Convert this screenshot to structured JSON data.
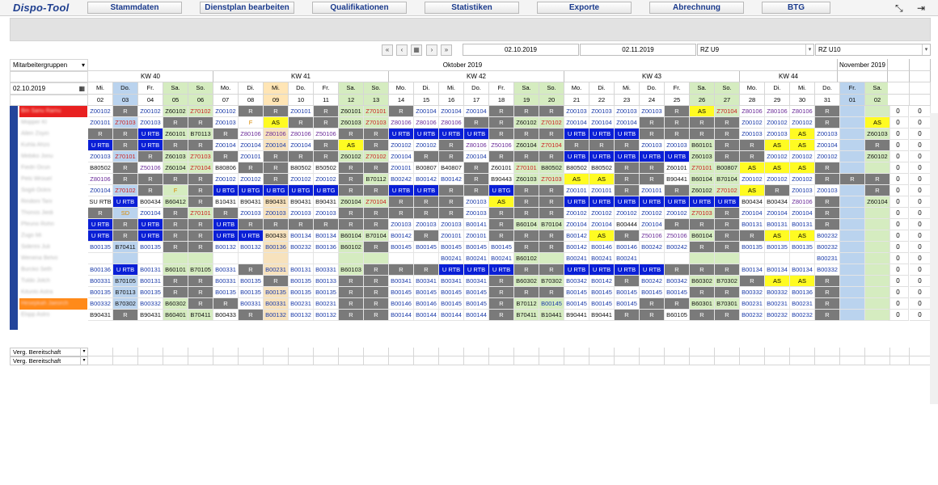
{
  "app": {
    "title": "Dispo-Tool"
  },
  "nav": [
    "Stammdaten",
    "Dienstplan bearbeiten",
    "Qualifikationen",
    "Statistiken",
    "Exporte",
    "Abrechnung",
    "BTG"
  ],
  "icons": {
    "collapse": "collapse-arrows-icon",
    "logout": "logout-icon"
  },
  "toolbar": {
    "first": "«",
    "prev": "‹",
    "calendar": "calendar-icon",
    "next": "›",
    "last": "»",
    "date_from": "02.10.2019",
    "date_to": "02.11.2019",
    "rz_left": "RZ U9",
    "rz_right": "RZ U10"
  },
  "filters": {
    "group_label": "Mitarbeitergruppen",
    "date": "02.10.2019"
  },
  "months": [
    {
      "label": "Oktober 2019"
    },
    {
      "label": "November 2019"
    }
  ],
  "weeks": [
    "KW 40",
    "KW 41",
    "KW 42",
    "KW 43",
    "KW 44"
  ],
  "days": [
    {
      "d": "Mi.",
      "n": "02",
      "k": "dn"
    },
    {
      "d": "Do.",
      "n": "03",
      "k": "dn h"
    },
    {
      "d": "Fr.",
      "n": "04",
      "k": "dn"
    },
    {
      "d": "Sa.",
      "n": "05",
      "k": "dn w"
    },
    {
      "d": "So.",
      "n": "06",
      "k": "dn w"
    },
    {
      "d": "Mo.",
      "n": "07",
      "k": "dn"
    },
    {
      "d": "Di.",
      "n": "08",
      "k": "dn"
    },
    {
      "d": "Mi.",
      "n": "09",
      "k": "dn s"
    },
    {
      "d": "Do.",
      "n": "10",
      "k": "dn"
    },
    {
      "d": "Fr.",
      "n": "11",
      "k": "dn"
    },
    {
      "d": "Sa.",
      "n": "12",
      "k": "dn w"
    },
    {
      "d": "So.",
      "n": "13",
      "k": "dn w"
    },
    {
      "d": "Mo.",
      "n": "14",
      "k": "dn"
    },
    {
      "d": "Di.",
      "n": "15",
      "k": "dn"
    },
    {
      "d": "Mi.",
      "n": "16",
      "k": "dn"
    },
    {
      "d": "Do.",
      "n": "17",
      "k": "dn"
    },
    {
      "d": "Fr.",
      "n": "18",
      "k": "dn"
    },
    {
      "d": "Sa.",
      "n": "19",
      "k": "dn w"
    },
    {
      "d": "So.",
      "n": "20",
      "k": "dn w"
    },
    {
      "d": "Mo.",
      "n": "21",
      "k": "dn"
    },
    {
      "d": "Di.",
      "n": "22",
      "k": "dn"
    },
    {
      "d": "Mi.",
      "n": "23",
      "k": "dn"
    },
    {
      "d": "Do.",
      "n": "24",
      "k": "dn"
    },
    {
      "d": "Fr.",
      "n": "25",
      "k": "dn"
    },
    {
      "d": "Sa.",
      "n": "26",
      "k": "dn w"
    },
    {
      "d": "So.",
      "n": "27",
      "k": "dn w"
    },
    {
      "d": "Mo.",
      "n": "28",
      "k": "dn"
    },
    {
      "d": "Di.",
      "n": "29",
      "k": "dn"
    },
    {
      "d": "Mi.",
      "n": "30",
      "k": "dn"
    },
    {
      "d": "Do.",
      "n": "31",
      "k": "dn"
    },
    {
      "d": "Fr.",
      "n": "01",
      "k": "dn h"
    },
    {
      "d": "Sa.",
      "n": "02",
      "k": "dn w"
    }
  ],
  "rows": [
    {
      "cells": [
        "Z00102",
        "R",
        "Z00102",
        "Z60102",
        "Z70102",
        "Z00102",
        "R",
        "R",
        "Z00101",
        "R",
        "Z60101",
        "Z70101",
        "R",
        "Z00104",
        "Z00104",
        "Z00104",
        "R",
        "R",
        "R",
        "Z00103",
        "Z00103",
        "Z00103",
        "Z00103",
        "R",
        "AS",
        "Z70104",
        "Z80106",
        "Z80106",
        "Z80106",
        "R",
        "",
        ""
      ],
      "a": "0",
      "b": "0"
    },
    {
      "cells": [
        "Z00101",
        "Z70103",
        "Z00103",
        "R",
        "R",
        "Z00103",
        "F",
        "AS",
        "R",
        "R",
        "Z60103",
        "Z70103",
        "Z80106",
        "Z80106",
        "Z80106",
        "R",
        "R",
        "Z60102",
        "Z70102",
        "Z00104",
        "Z00104",
        "Z00104",
        "R",
        "R",
        "R",
        "R",
        "Z00102",
        "Z00102",
        "Z00102",
        "R",
        "",
        "AS"
      ],
      "a": "0",
      "b": "0"
    },
    {
      "cells": [
        "R",
        "R",
        "U RTB",
        "Z60101",
        "B70113",
        "R",
        "Z80106",
        "Z80106",
        "Z80106",
        "Z50106",
        "R",
        "R",
        "U RTB",
        "U RTB",
        "U RTB",
        "U RTB",
        "R",
        "R",
        "R",
        "U RTB",
        "U RTB",
        "U RTB",
        "R",
        "R",
        "R",
        "R",
        "Z00103",
        "Z00103",
        "AS",
        "Z00103",
        "",
        "Z60103"
      ],
      "a": "0",
      "b": "0"
    },
    {
      "cells": [
        "U RTB",
        "R",
        "U RTB",
        "R",
        "R",
        "Z00104",
        "Z00104",
        "Z00104",
        "Z00104",
        "R",
        "AS",
        "R",
        "Z00102",
        "Z00102",
        "R",
        "Z80106",
        "Z50106",
        "Z60104",
        "Z70104",
        "R",
        "R",
        "R",
        "Z00103",
        "Z00103",
        "B60101",
        "R",
        "R",
        "AS",
        "AS",
        "Z00104",
        "",
        "R"
      ],
      "a": "0",
      "b": "0"
    },
    {
      "cells": [
        "Z00103",
        "Z70101",
        "R",
        "Z60103",
        "Z70103",
        "R",
        "Z00101",
        "R",
        "R",
        "R",
        "Z60102",
        "Z70102",
        "Z00104",
        "R",
        "R",
        "Z00104",
        "R",
        "R",
        "R",
        "U RTB",
        "U RTB",
        "U RTB",
        "U RTB",
        "U RTB",
        "Z60103",
        "R",
        "R",
        "Z00102",
        "Z00102",
        "Z00102",
        "",
        "Z60102"
      ],
      "a": "0",
      "b": "0"
    },
    {
      "cells": [
        "B80502",
        "R",
        "Z50106",
        "Z60104",
        "Z70104",
        "B80806",
        "R",
        "R",
        "B80502",
        "B50502",
        "R",
        "R",
        "Z00101",
        "B00807",
        "B40807",
        "R",
        "Z60101",
        "Z70101",
        "B80502",
        "B80502",
        "B80502",
        "R",
        "R",
        "Z60101",
        "Z70101",
        "B00807",
        "AS",
        "AS",
        "AS",
        "R",
        "",
        ""
      ],
      "a": "0",
      "b": "0"
    },
    {
      "cells": [
        "Z80106",
        "R",
        "R",
        "R",
        "R",
        "Z00102",
        "Z00102",
        "R",
        "Z00102",
        "Z00102",
        "R",
        "B70112",
        "B00242",
        "B00142",
        "B00142",
        "R",
        "B90443",
        "Z60103",
        "Z70103",
        "AS",
        "AS",
        "R",
        "R",
        "B90441",
        "B60104",
        "B70104",
        "Z00102",
        "Z00102",
        "Z00102",
        "R",
        "R",
        "R"
      ],
      "a": "0",
      "b": "0"
    },
    {
      "cells": [
        "Z00104",
        "Z70102",
        "R",
        "F",
        "R",
        "U BTG",
        "U BTG",
        "U BTG",
        "U BTG",
        "U BTG",
        "R",
        "R",
        "U RTB",
        "U RTB",
        "R",
        "R",
        "U BTG",
        "R",
        "R",
        "Z00101",
        "Z00101",
        "R",
        "Z00101",
        "R",
        "Z60102",
        "Z70102",
        "AS",
        "R",
        "Z00103",
        "Z00103",
        "",
        "R"
      ],
      "a": "0",
      "b": "0"
    },
    {
      "cells": [
        "SU RTB",
        "U RTB",
        "B00434",
        "B60412",
        "R",
        "B10431",
        "B90431",
        "B90431",
        "B90431",
        "B90431",
        "Z60104",
        "Z70104",
        "R",
        "R",
        "R",
        "Z00103",
        "AS",
        "R",
        "R",
        "U RTB",
        "U RTB",
        "U RTB",
        "U RTB",
        "U RTB",
        "U RTB",
        "U RTB",
        "B00434",
        "B00434",
        "Z80106",
        "R",
        "",
        "Z60104"
      ],
      "a": "0",
      "b": "0"
    },
    {
      "cells": [
        "R",
        "SD",
        "Z00104",
        "R",
        "Z70101",
        "R",
        "Z00103",
        "Z00103",
        "Z00103",
        "Z00103",
        "R",
        "R",
        "R",
        "R",
        "R",
        "Z00103",
        "R",
        "R",
        "R",
        "Z00102",
        "Z00102",
        "Z00102",
        "Z00102",
        "Z00102",
        "Z70103",
        "R",
        "Z00104",
        "Z00104",
        "Z00104",
        "R",
        "",
        ""
      ],
      "a": "0",
      "b": "0"
    },
    {
      "cells": [
        "U RTB",
        "R",
        "U RTB",
        "R",
        "R",
        "U RTB",
        "R",
        "R",
        "R",
        "R",
        "R",
        "R",
        "Z00103",
        "Z00103",
        "Z00103",
        "B00141",
        "R",
        "B60104",
        "B70104",
        "Z00104",
        "Z00104",
        "B00444",
        "Z00104",
        "R",
        "R",
        "R",
        "B00131",
        "B00131",
        "B00131",
        "R",
        "",
        ""
      ],
      "a": "0",
      "b": "0"
    },
    {
      "cells": [
        "U RTB",
        "R",
        "U RTB",
        "R",
        "R",
        "U RTB",
        "U RTB",
        "B00433",
        "B00134",
        "B00134",
        "B60104",
        "B70104",
        "B00142",
        "R",
        "Z00101",
        "Z00101",
        "R",
        "R",
        "R",
        "B00142",
        "AS",
        "R",
        "Z50106",
        "Z50106",
        "B60104",
        "R",
        "R",
        "AS",
        "AS",
        "B00232",
        "",
        ""
      ],
      "a": "0",
      "b": "0"
    },
    {
      "cells": [
        "B00135",
        "B70411",
        "B00135",
        "R",
        "R",
        "B00132",
        "B00132",
        "B00136",
        "B00232",
        "B00136",
        "B60102",
        "R",
        "B00145",
        "B00145",
        "B00145",
        "B00145",
        "B00145",
        "R",
        "R",
        "B00142",
        "B00146",
        "B00146",
        "B00242",
        "B00242",
        "R",
        "R",
        "B00135",
        "B00135",
        "B00135",
        "B00232",
        "",
        ""
      ],
      "a": "0",
      "b": "0"
    },
    {
      "cells": [
        "",
        "",
        "",
        "",
        "",
        "",
        "",
        "",
        "",
        "",
        "",
        "",
        "",
        "",
        "B00241",
        "B00241",
        "B00241",
        "B60102",
        "",
        "B00241",
        "B00241",
        "B00241",
        "",
        "",
        "",
        "",
        "",
        "",
        "",
        "B00231",
        "",
        ""
      ],
      "a": "0",
      "b": "0"
    },
    {
      "cells": [
        "B00136",
        "U RTB",
        "B00131",
        "B60101",
        "B70105",
        "B00331",
        "R",
        "B00231",
        "B00131",
        "B00331",
        "B60103",
        "R",
        "R",
        "R",
        "U RTB",
        "U RTB",
        "U RTB",
        "R",
        "R",
        "U RTB",
        "U RTB",
        "U RTB",
        "U RTB",
        "R",
        "R",
        "R",
        "B00134",
        "B00134",
        "B00134",
        "B00332",
        "",
        ""
      ],
      "a": "0",
      "b": "0"
    },
    {
      "cells": [
        "B00331",
        "B70105",
        "B00131",
        "R",
        "R",
        "B00331",
        "B00135",
        "R",
        "B00135",
        "B00133",
        "R",
        "R",
        "B00341",
        "B00341",
        "B00341",
        "B00341",
        "R",
        "B60302",
        "B70302",
        "B00342",
        "B00142",
        "R",
        "B00242",
        "B00342",
        "B60302",
        "B70302",
        "R",
        "AS",
        "AS",
        "R",
        "",
        ""
      ],
      "a": "0",
      "b": "0"
    },
    {
      "cells": [
        "B00135",
        "B70113",
        "B00135",
        "R",
        "R",
        "B00135",
        "B00135",
        "B00135",
        "B00135",
        "B00135",
        "R",
        "R",
        "B00145",
        "B00145",
        "B00145",
        "B00145",
        "R",
        "R",
        "R",
        "B00145",
        "B00145",
        "B00145",
        "B00145",
        "B00145",
        "R",
        "R",
        "B00332",
        "B00332",
        "B00136",
        "R",
        "",
        ""
      ],
      "a": "0",
      "b": "0"
    },
    {
      "cells": [
        "B00332",
        "B70302",
        "B00332",
        "B60302",
        "R",
        "R",
        "B00331",
        "B00331",
        "B00231",
        "B00231",
        "R",
        "R",
        "B00146",
        "B00146",
        "B00145",
        "B00145",
        "R",
        "B70112",
        "B00145",
        "B00145",
        "B00145",
        "B00145",
        "R",
        "R",
        "B60301",
        "B70301",
        "B00231",
        "B00231",
        "B00231",
        "R",
        "",
        ""
      ],
      "a": "0",
      "b": "0"
    },
    {
      "cells": [
        "B90431",
        "R",
        "B90431",
        "B60401",
        "B70411",
        "B00433",
        "R",
        "B00132",
        "B00132",
        "B00132",
        "R",
        "R",
        "B00144",
        "B00144",
        "B00144",
        "B00144",
        "R",
        "B70411",
        "B10441",
        "B90441",
        "B90441",
        "R",
        "R",
        "B60105",
        "R",
        "R",
        "B00232",
        "B00232",
        "B00232",
        "R",
        "",
        ""
      ],
      "a": "0",
      "b": "0"
    }
  ],
  "footer": [
    "Verg. Bereitschaft",
    "Verg. Bereitschaft"
  ]
}
